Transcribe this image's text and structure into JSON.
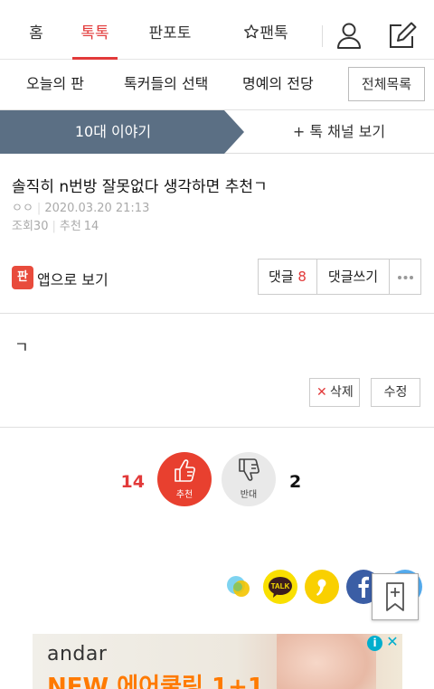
{
  "topnav": {
    "tabs": [
      {
        "label": "홈",
        "active": false
      },
      {
        "label": "톡톡",
        "active": true
      },
      {
        "label": "판포토",
        "active": false
      },
      {
        "label": "팬톡",
        "active": false,
        "icon": "star-outline-icon"
      }
    ],
    "icons": [
      "user-icon",
      "edit-icon"
    ]
  },
  "subnav": {
    "items": [
      "오늘의 판",
      "톡커들의 선택",
      "명예의 전당"
    ],
    "all_label": "전체목록"
  },
  "channel": {
    "current": "10대 이야기",
    "more": "+ 톡 채널 보기",
    "color": "#5b6f84"
  },
  "post": {
    "title": "솔직히 n번방 잘못없다 생각하면 추천ㄱ",
    "author": "ㅇㅇ",
    "date": "2020.03.20 21:13",
    "views_label": "조회",
    "views": "30",
    "recommend_label": "추천",
    "recommends": "14",
    "body": "ㄱ"
  },
  "app_view": {
    "logo_text": "판",
    "label": "앱으로 보기"
  },
  "comment_bar": {
    "comment_label": "댓글",
    "comment_count": "8",
    "write_label": "댓글쓰기",
    "more_icon": "more-dots-icon"
  },
  "actions": {
    "delete_label": "삭제",
    "edit_label": "수정"
  },
  "vote": {
    "up_count": "14",
    "up_label": "추천",
    "down_count": "2",
    "down_label": "반대"
  },
  "share": {
    "icons": [
      "chat-bubble-share-icon",
      "kakaotalk-icon",
      "kakaostory-icon",
      "facebook-icon",
      "twitter-icon"
    ],
    "kakao_label": "TALK",
    "bookmark_icon": "bookmark-add-icon"
  },
  "ad": {
    "brand": "andar",
    "promo": "NEW 에어쿨링 1+1",
    "info_icon": "info-icon",
    "close_icon": "close-icon"
  }
}
